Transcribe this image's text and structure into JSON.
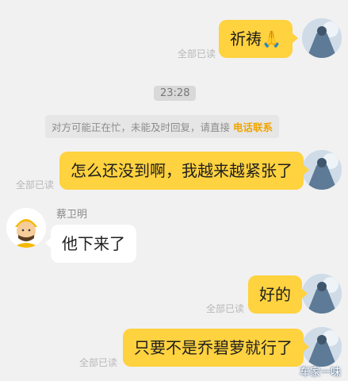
{
  "messages": [
    {
      "text": "祈祷🙏",
      "read": "全部已读"
    },
    {
      "text": "怎么还没到啊，我越来越紧张了",
      "read": "全部已读"
    },
    {
      "text": "他下来了",
      "sender": "蔡卫明"
    },
    {
      "text": "好的",
      "read": "全部已读"
    },
    {
      "text": "只要不是乔碧萝就行了",
      "read": "全部已读"
    }
  ],
  "timestamp": "23:28",
  "system_note": {
    "text": "对方可能正在忙，未能及时回复，请直接",
    "link": "电话联系"
  },
  "watermark": "车家一味",
  "colors": {
    "bubble_me": "#ffd23f",
    "bubble_other": "#ffffff",
    "background": "#f1f1f1",
    "link": "#f0a500"
  }
}
